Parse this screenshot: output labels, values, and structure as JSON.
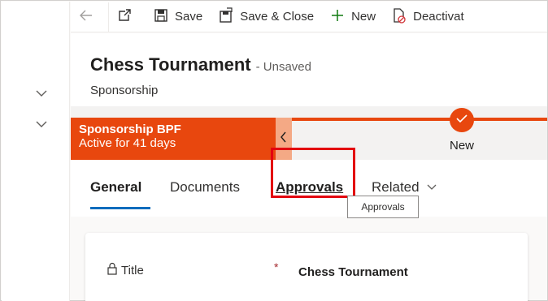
{
  "commandbar": {
    "save_label": "Save",
    "save_close_label": "Save & Close",
    "new_label": "New",
    "deactivate_label": "Deactivat"
  },
  "header": {
    "title": "Chess Tournament",
    "status": "- Unsaved",
    "entity": "Sponsorship"
  },
  "bpf": {
    "name": "Sponsorship BPF",
    "active": "Active for 41 days",
    "stage_label": "New"
  },
  "tabs": {
    "general": "General",
    "documents": "Documents",
    "approvals": "Approvals",
    "related": "Related"
  },
  "tooltip": "Approvals",
  "form": {
    "title_label": "Title",
    "required_marker": "*",
    "title_value": "Chess Tournament"
  },
  "colors": {
    "bpf_accent": "#e8470e",
    "tab_underline": "#0f6cbd",
    "highlight": "#e3000f"
  },
  "icons": [
    "back-arrow-icon",
    "popout-icon",
    "save-icon",
    "save-close-icon",
    "plus-icon",
    "deactivate-icon",
    "chevron-down-icon",
    "chevron-left-icon",
    "checkmark-icon",
    "lock-icon"
  ]
}
